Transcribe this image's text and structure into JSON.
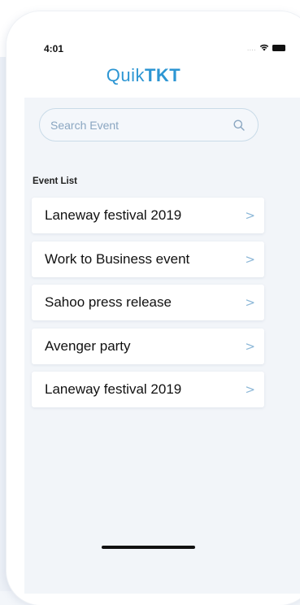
{
  "status_bar": {
    "time": "4:01",
    "signal_dots": "....",
    "icons": [
      "wifi-icon",
      "battery-icon"
    ]
  },
  "app": {
    "title_light": "Quik",
    "title_bold": "TKT",
    "accent_color": "#2d96d3"
  },
  "search": {
    "placeholder": "Search Event",
    "icon": "search-icon"
  },
  "section": {
    "label": "Event List"
  },
  "events": [
    {
      "name": "Laneway festival 2019"
    },
    {
      "name": "Work to Business event"
    },
    {
      "name": "Sahoo press release"
    },
    {
      "name": "Avenger party"
    },
    {
      "name": "Laneway festival 2019"
    }
  ],
  "chevron": ">"
}
